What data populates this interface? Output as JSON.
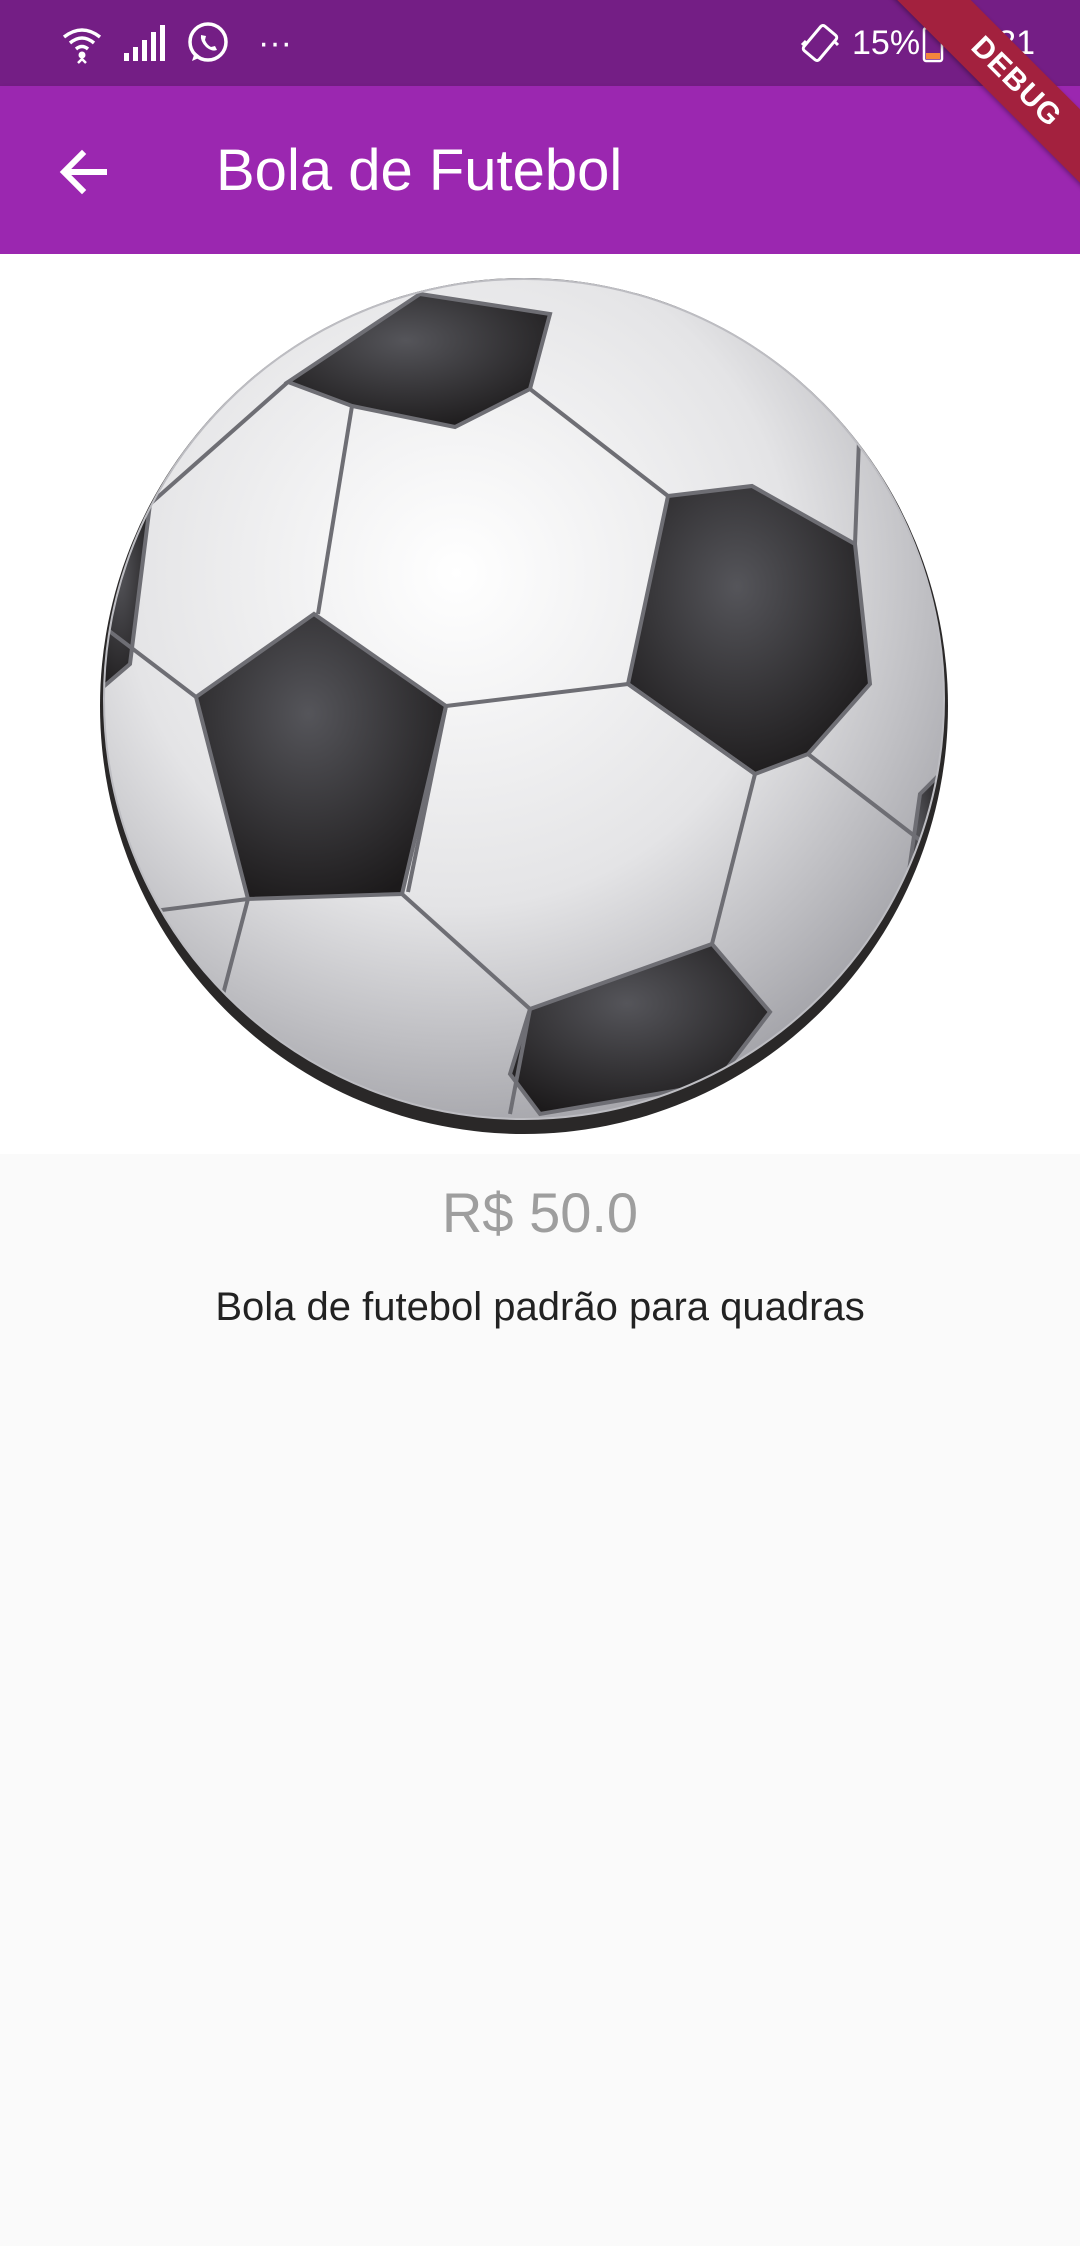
{
  "status_bar": {
    "battery": "15%",
    "time": "20:31",
    "overflow": "···"
  },
  "app_bar": {
    "title": "Bola de Futebol",
    "back_icon": "arrow-back-icon"
  },
  "debug_banner": "DEBUG",
  "product": {
    "image": "soccer-ball",
    "price": "R$ 50.0",
    "description": "Bola de futebol padrão para quadras"
  },
  "colors": {
    "status_bar": "#741e85",
    "app_bar": "#9b27b0",
    "price": "#9e9e9e",
    "banner": "#a3213e"
  }
}
